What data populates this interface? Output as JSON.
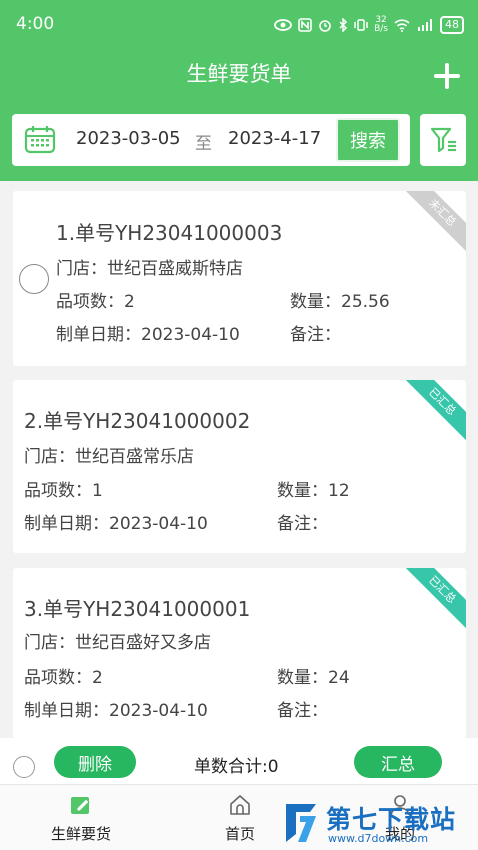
{
  "status_bar": {
    "time": "4:00",
    "network_speed": "32\nB/s",
    "battery": "48",
    "icons": [
      "eye-icon",
      "nfc-icon",
      "alarm-icon",
      "bluetooth-icon",
      "vibrate-icon",
      "wifi-icon",
      "signal-icon",
      "battery-icon"
    ]
  },
  "header": {
    "title": "生鲜要货单",
    "add_icon": "plus-icon"
  },
  "search": {
    "start_date": "2023-03-05",
    "separator": "至",
    "end_date": "2023-4-17",
    "button_label": "搜索",
    "calendar_icon": "calendar-icon",
    "filter_icon": "filter-icon"
  },
  "orders": [
    {
      "order_no": "1.单号YH23041000003",
      "store": "门店：世纪百盛威斯特店",
      "items": "品项数：2",
      "quantity": "数量：25.56",
      "date": "制单日期：2023-04-10",
      "remark": "备注：",
      "status": "未汇总",
      "status_color": "#cfcfcf"
    },
    {
      "order_no": "2.单号YH23041000002",
      "store": "门店：世纪百盛常乐店",
      "items": "品项数：1",
      "quantity": "数量：12",
      "date": "制单日期：2023-04-10",
      "remark": "备注：",
      "status": "已汇总",
      "status_color": "#37c6a9"
    },
    {
      "order_no": "3.单号YH23041000001",
      "store": "门店：世纪百盛好又多店",
      "items": "品项数：2",
      "quantity": "数量：24",
      "date": "制单日期：2023-04-10",
      "remark": "备注：",
      "status": "已汇总",
      "status_color": "#37c6a9"
    }
  ],
  "footer": {
    "delete_label": "删除",
    "total_label": "单数合计:0",
    "summary_label": "汇总"
  },
  "tabs": [
    {
      "label": "生鲜要货",
      "icon": "fresh-order-icon"
    },
    {
      "label": "首页",
      "icon": "home-icon"
    },
    {
      "label": "我的",
      "icon": "user-icon"
    }
  ],
  "watermark": {
    "text": "第七下载站",
    "url": "www.d7down.com"
  },
  "colors": {
    "brand_green": "#52c668",
    "button_green": "#26b760",
    "summarized_teal": "#37c6a9",
    "unsummarized_gray": "#cfcfcf"
  }
}
